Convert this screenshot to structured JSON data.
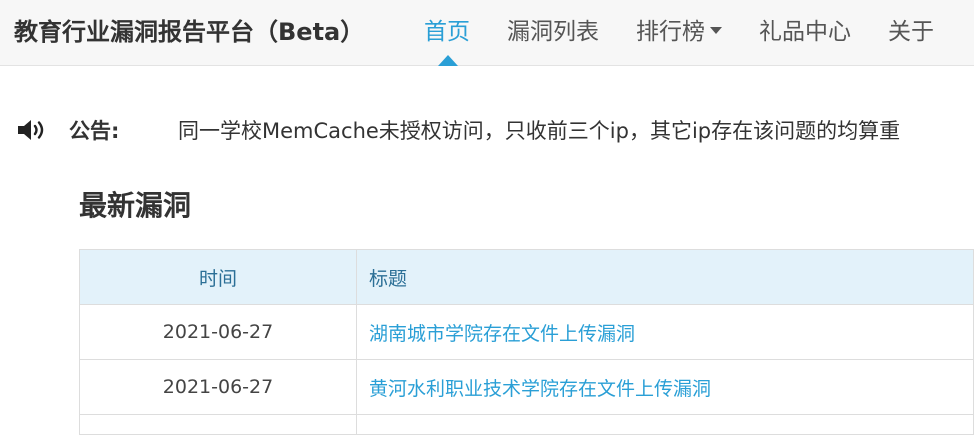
{
  "header": {
    "brand": "教育行业漏洞报告平台（Beta）",
    "nav": [
      {
        "label": "首页",
        "active": true,
        "dropdown": false
      },
      {
        "label": "漏洞列表",
        "active": false,
        "dropdown": false
      },
      {
        "label": "排行榜",
        "active": false,
        "dropdown": true
      },
      {
        "label": "礼品中心",
        "active": false,
        "dropdown": false
      },
      {
        "label": "关于",
        "active": false,
        "dropdown": false
      }
    ]
  },
  "notice": {
    "icon": "speaker-icon",
    "label": "公告:",
    "text": "同一学校MemCache未授权访问，只收前三个ip，其它ip存在该问题的均算重"
  },
  "latest": {
    "title": "最新漏洞",
    "columns": {
      "time": "时间",
      "title": "标题"
    },
    "rows": [
      {
        "time": "2021-06-27",
        "title": "湖南城市学院存在文件上传漏洞"
      },
      {
        "time": "2021-06-27",
        "title": "黄河水利职业技术学院存在文件上传漏洞"
      }
    ]
  },
  "colors": {
    "accent": "#2a9fd6",
    "navbar_bg": "#f7f7f7",
    "table_header_bg": "#e3f2fa"
  }
}
